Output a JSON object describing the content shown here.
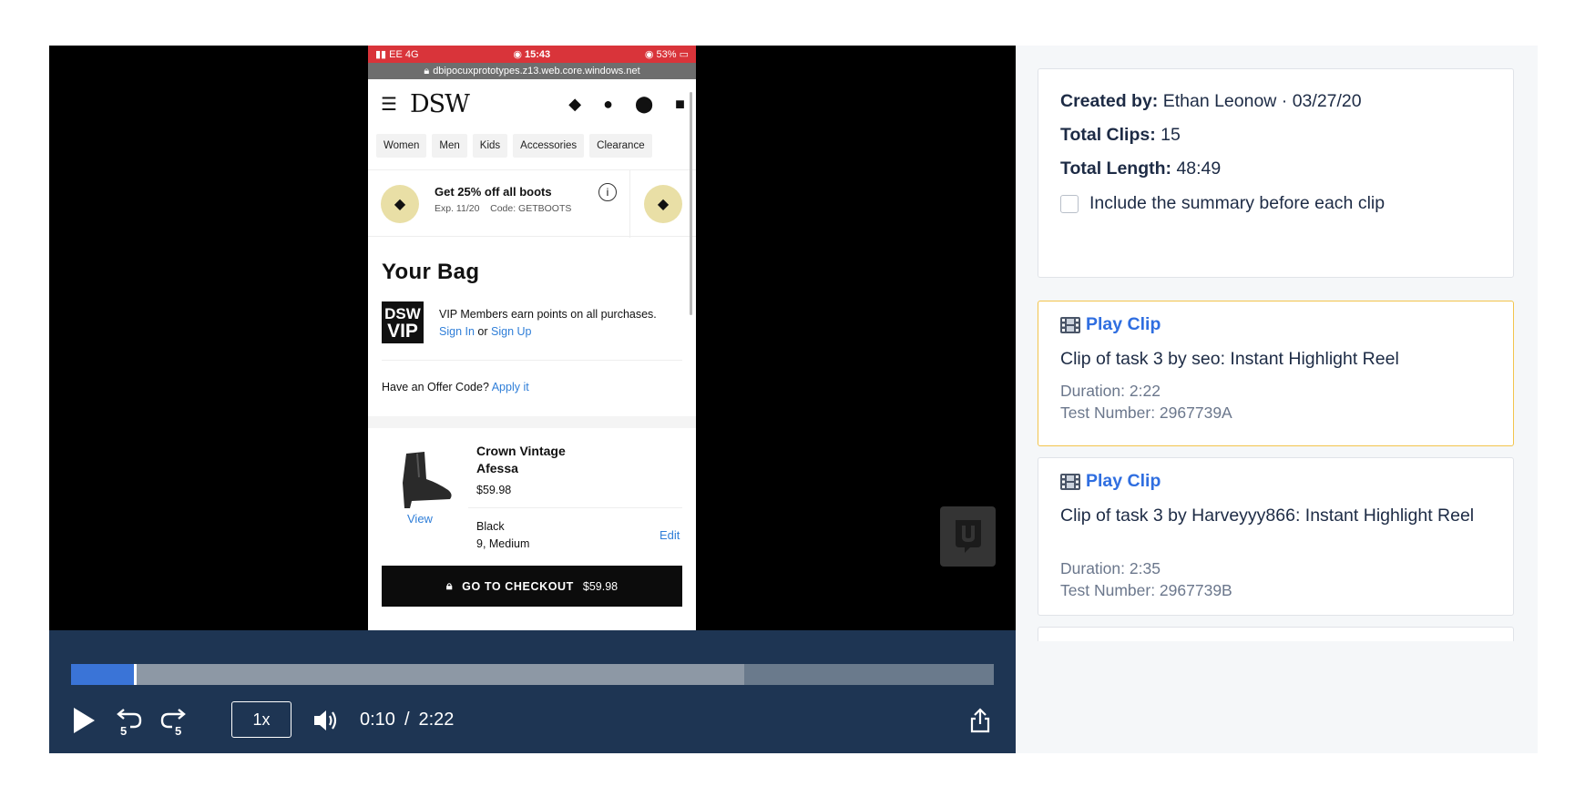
{
  "phone": {
    "status": {
      "carrier": "EE",
      "network": "4G",
      "time": "15:43",
      "battery": "53%"
    },
    "url": "dbipocuxprototypes.z13.web.core.windows.net",
    "logo": "DSW",
    "categories": [
      "Women",
      "Men",
      "Kids",
      "Accessories",
      "Clearance"
    ],
    "promo": {
      "title": "Get 25% off all boots",
      "expiry": "Exp. 11/20",
      "code": "Code: GETBOOTS",
      "info": "i"
    },
    "bag_title": "Your Bag",
    "vip": {
      "logo_top": "DSW",
      "logo_bottom": "VIP",
      "text": "VIP Members earn points on all purchases.",
      "sign_in": "Sign In",
      "or": "or",
      "sign_up": "Sign Up"
    },
    "offer": {
      "label": "Have an Offer Code?",
      "link": "Apply it"
    },
    "product": {
      "name": "Crown Vintage Afessa",
      "price": "$59.98",
      "view": "View",
      "color": "Black",
      "size": "9, Medium",
      "edit": "Edit"
    },
    "checkout": {
      "label": "GO TO CHECKOUT",
      "price": "$59.98"
    }
  },
  "player": {
    "progress": {
      "played_fraction": 0.069,
      "buffered_fraction": 0.73
    },
    "speed": "1x",
    "current_time": "0:10",
    "separator": "/",
    "total_time": "2:22",
    "icons": {
      "play": "play-icon",
      "rewind": "rewind-5-icon",
      "forward": "forward-5-icon",
      "volume": "volume-icon",
      "share": "share-icon"
    },
    "skip_seconds": "5",
    "colors": {
      "bar_bg": "#1e3553",
      "played": "#3a74d7"
    }
  },
  "sidebar": {
    "info": {
      "created_by_label": "Created by:",
      "created_by_value": "Ethan Leonow · 03/27/20",
      "total_clips_label": "Total Clips:",
      "total_clips_value": "15",
      "total_length_label": "Total Length:",
      "total_length_value": "48:49",
      "include_summary": "Include the summary before each clip"
    },
    "clips": [
      {
        "play_label": "Play Clip",
        "title": "Clip of task 3 by seo: Instant Highlight Reel",
        "duration": "Duration: 2:22",
        "test_number": "Test Number: 2967739A"
      },
      {
        "play_label": "Play Clip",
        "title": "Clip of task 3 by Harveyyy866: Instant Highlight Reel",
        "duration": "Duration: 2:35",
        "test_number": "Test Number: 2967739B"
      }
    ],
    "colors": {
      "link": "#2f6ee0",
      "active_border": "#f2c44d"
    }
  }
}
